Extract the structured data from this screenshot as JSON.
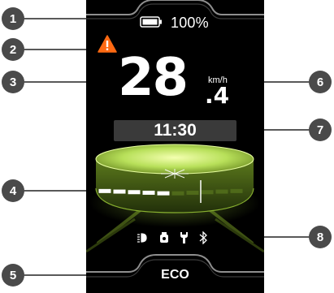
{
  "display": {
    "battery_percent": "100%",
    "speed_integer": "28",
    "speed_decimal": ".4",
    "speed_unit": "km/h",
    "time": "11:30",
    "assist_level": 5,
    "assist_level_max": 10,
    "mode": "ECO"
  },
  "status_icons": [
    "headlight-icon",
    "motor-icon",
    "wrench-icon",
    "bluetooth-icon"
  ],
  "callouts": [
    "1",
    "2",
    "3",
    "4",
    "5",
    "6",
    "7",
    "8"
  ],
  "colors": {
    "background": "#000000",
    "accent_lime": "#c8f06a",
    "warning_orange": "#ff6a13",
    "callout_badge": "#4a4a4a"
  }
}
